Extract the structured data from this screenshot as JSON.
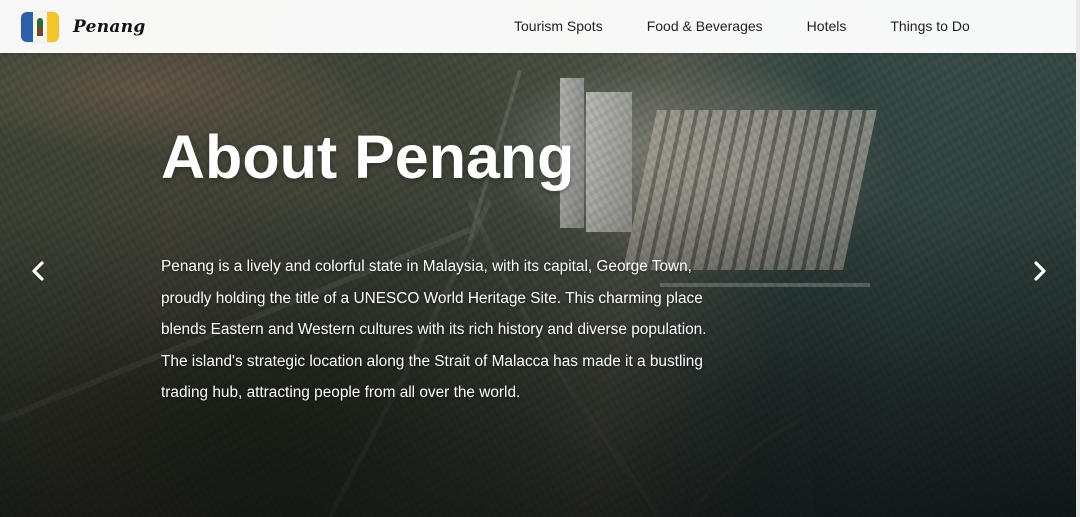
{
  "brand": {
    "name": "Penang",
    "logo_icon": "penang-flag-logo"
  },
  "nav": {
    "links": [
      {
        "label": "Tourism Spots"
      },
      {
        "label": "Food & Beverages"
      },
      {
        "label": "Hotels"
      },
      {
        "label": "Things to Do"
      }
    ]
  },
  "hero": {
    "title": "About Penang",
    "description": "Penang is a lively and colorful state in Malaysia, with its capital, George Town, proudly holding the title of a UNESCO World Heritage Site. This charming place blends Eastern and Western cultures with its rich history and diverse population. The island's strategic location along the Strait of Malacca has made it a bustling trading hub, attracting people from all over the world.",
    "prev_icon": "chevron-left-icon",
    "next_icon": "chevron-right-icon"
  },
  "colors": {
    "navbar_bg": "#ffffff",
    "text_on_hero": "#ffffff",
    "nav_text": "#222222"
  }
}
